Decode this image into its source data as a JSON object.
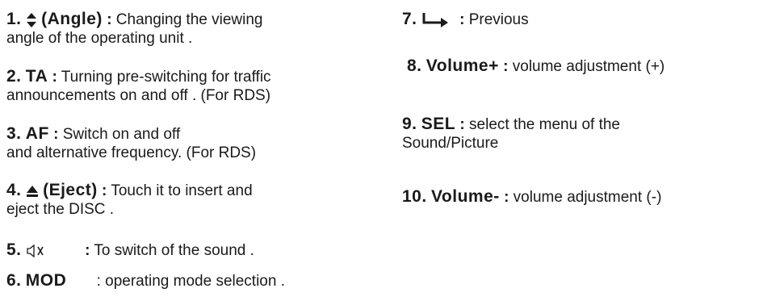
{
  "items": [
    {
      "num": "1.",
      "key": "(Angle)",
      "icon": "up-down-arrow-icon",
      "line1": "Changing the viewing",
      "line2": "angle of the operating unit ."
    },
    {
      "num": "2.",
      "key": "TA",
      "line1": "Turning pre-switching for traffic",
      "line2": "announcements on and off . (For RDS)"
    },
    {
      "num": "3.",
      "key": "AF",
      "line1": "Switch on and off",
      "line2": "and alternative frequency. (For RDS)"
    },
    {
      "num": "4.",
      "key": "(Eject)",
      "icon": "eject-icon",
      "line1": "Touch it to insert and",
      "line2": "eject the DISC ."
    },
    {
      "num": "5.",
      "icon": "mute-icon",
      "line1": "To switch of the sound ."
    },
    {
      "num": "6.",
      "key": "MOD",
      "line1": "operating mode selection ."
    },
    {
      "num": "7.",
      "icon": "return-arrow-icon",
      "line1": "Previous"
    },
    {
      "num": "8.",
      "key": "Volume+",
      "line1": "volume adjustment (+)"
    },
    {
      "num": "9.",
      "key": "SEL",
      "line1": "select the menu of the",
      "line2": "Sound/Picture"
    },
    {
      "num": "10.",
      "key": "Volume-",
      "line1": "volume adjustment (-)"
    }
  ]
}
